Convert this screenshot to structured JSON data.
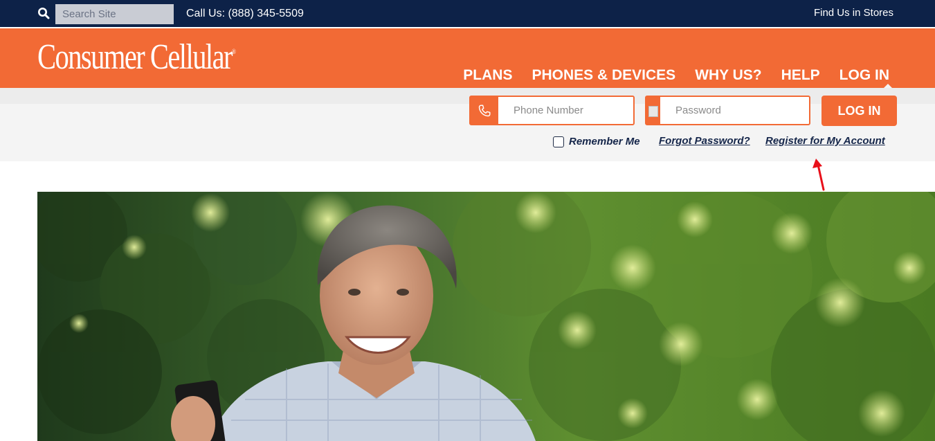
{
  "topbar": {
    "search_placeholder": "Search Site",
    "call_us": "Call Us: (888) 345-5509",
    "find_stores": "Find Us in Stores"
  },
  "header": {
    "logo_text": "Consumer Cellular",
    "nav": [
      "PLANS",
      "PHONES & DEVICES",
      "WHY US?",
      "HELP",
      "LOG IN"
    ]
  },
  "login": {
    "phone_placeholder": "Phone Number",
    "password_placeholder": "Password",
    "login_button": "LOG IN",
    "remember_me": "Remember Me",
    "remember_checked": false,
    "forgot_password": "Forgot Password?",
    "register": "Register for My Account"
  },
  "colors": {
    "navy": "#0d2248",
    "orange": "#f26a35",
    "link_navy": "#15264a",
    "annotation_red": "#e8101a"
  },
  "icons": {
    "search": "search-icon",
    "phone": "phone-icon",
    "password": "broken-image-icon",
    "annotation": "red-arrow-icon"
  }
}
